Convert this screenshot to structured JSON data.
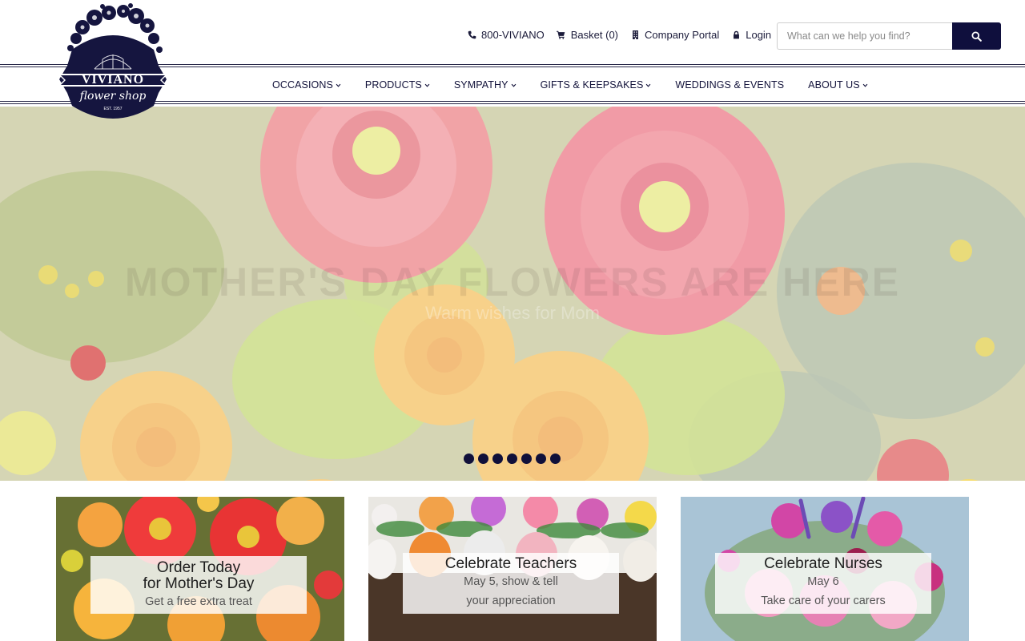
{
  "brand": {
    "name": "VIVIANO",
    "script": "flower shop",
    "est": "EST. 1957"
  },
  "utility": {
    "phone": "800-VIVIANO",
    "basket": "Basket (0)",
    "portal": "Company Portal",
    "login": "Login"
  },
  "search": {
    "placeholder": "What can we help you find?"
  },
  "nav": [
    {
      "label": "OCCASIONS",
      "dropdown": true
    },
    {
      "label": "PRODUCTS",
      "dropdown": true
    },
    {
      "label": "SYMPATHY",
      "dropdown": true
    },
    {
      "label": "GIFTS & KEEPSAKES",
      "dropdown": true
    },
    {
      "label": "WEDDINGS & EVENTS",
      "dropdown": false
    },
    {
      "label": "ABOUT US",
      "dropdown": true
    }
  ],
  "hero": {
    "headline": "MOTHER'S DAY FLOWERS ARE HERE",
    "subline": "Warm wishes for Mom",
    "slides": 7,
    "active_slide": 1
  },
  "cards": [
    {
      "title_line1": "Order Today",
      "title_line2": "for Mother's Day",
      "subtitle": "Get a free extra treat"
    },
    {
      "title_line1": "Celebrate Teachers",
      "subtitle_line1": "May 5, show & tell",
      "subtitle_line2": "your appreciation"
    },
    {
      "title_line1": "Celebrate Nurses",
      "subtitle_line1": "May 6",
      "subtitle_line2": "Take care of your carers"
    }
  ],
  "colors": {
    "navy": "#0f0f3d",
    "text": "#1b1b3a"
  },
  "icons": {
    "phone": "phone-icon",
    "basket": "cart-icon",
    "portal": "building-icon",
    "login": "lock-icon",
    "search": "search-icon"
  }
}
